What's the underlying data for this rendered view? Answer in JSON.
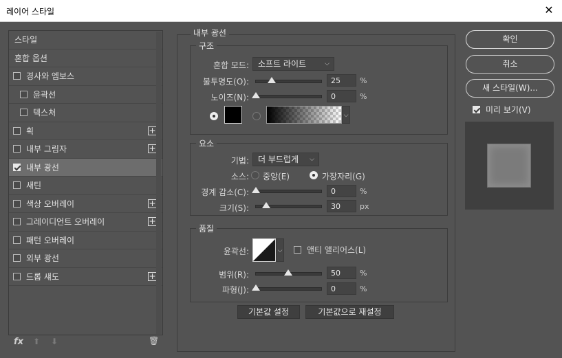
{
  "window": {
    "title": "레이어 스타일",
    "close_glyph": "✕"
  },
  "styles": [
    {
      "label": "스타일",
      "type": "plain"
    },
    {
      "label": "혼합 옵션",
      "type": "plain"
    },
    {
      "label": "경사와 엠보스",
      "type": "check",
      "checked": false
    },
    {
      "label": "윤곽선",
      "type": "sub",
      "checked": false
    },
    {
      "label": "텍스처",
      "type": "sub",
      "checked": false
    },
    {
      "label": "획",
      "type": "check",
      "checked": false,
      "plus": true
    },
    {
      "label": "내부 그림자",
      "type": "check",
      "checked": false,
      "plus": true
    },
    {
      "label": "내부 광선",
      "type": "check",
      "checked": true,
      "selected": true
    },
    {
      "label": "새틴",
      "type": "check",
      "checked": false
    },
    {
      "label": "색상 오버레이",
      "type": "check",
      "checked": false,
      "plus": true
    },
    {
      "label": "그레이디언트 오버레이",
      "type": "check",
      "checked": false,
      "plus": true
    },
    {
      "label": "패턴 오버레이",
      "type": "check",
      "checked": false
    },
    {
      "label": "외부 광선",
      "type": "check",
      "checked": false
    },
    {
      "label": "드롭 섀도",
      "type": "check",
      "checked": false,
      "plus": true
    }
  ],
  "footer": {
    "fx": "fx",
    "up": "⬆",
    "down": "⬇",
    "trash": "🗑"
  },
  "panel": {
    "title": "내부 광선",
    "structure": {
      "legend": "구조",
      "blend_label": "혼합 모드:",
      "blend_value": "소프트 라이트",
      "opacity_label": "불투명도(O):",
      "opacity_value": "25",
      "opacity_unit": "%",
      "noise_label": "노이즈(N):",
      "noise_value": "0",
      "noise_unit": "%",
      "color": "#000000"
    },
    "elements": {
      "legend": "요소",
      "technique_label": "기법:",
      "technique_value": "더 부드럽게",
      "source_label": "소스:",
      "source_center": "중앙(E)",
      "source_edge": "가장자리(G)",
      "choke_label": "경계 감소(C):",
      "choke_value": "0",
      "choke_unit": "%",
      "size_label": "크기(S):",
      "size_value": "30",
      "size_unit": "px"
    },
    "quality": {
      "legend": "품질",
      "contour_label": "윤곽선:",
      "antialias_label": "앤티 앨리어스(L)",
      "range_label": "범위(R):",
      "range_value": "50",
      "range_unit": "%",
      "jitter_label": "파형(J):",
      "jitter_value": "0",
      "jitter_unit": "%"
    },
    "make_default": "기본값 설정",
    "reset_default": "기본값으로 재설정"
  },
  "right": {
    "ok": "확인",
    "cancel": "취소",
    "new_style": "새 스타일(W)...",
    "preview_label": "미리 보기(V)"
  }
}
